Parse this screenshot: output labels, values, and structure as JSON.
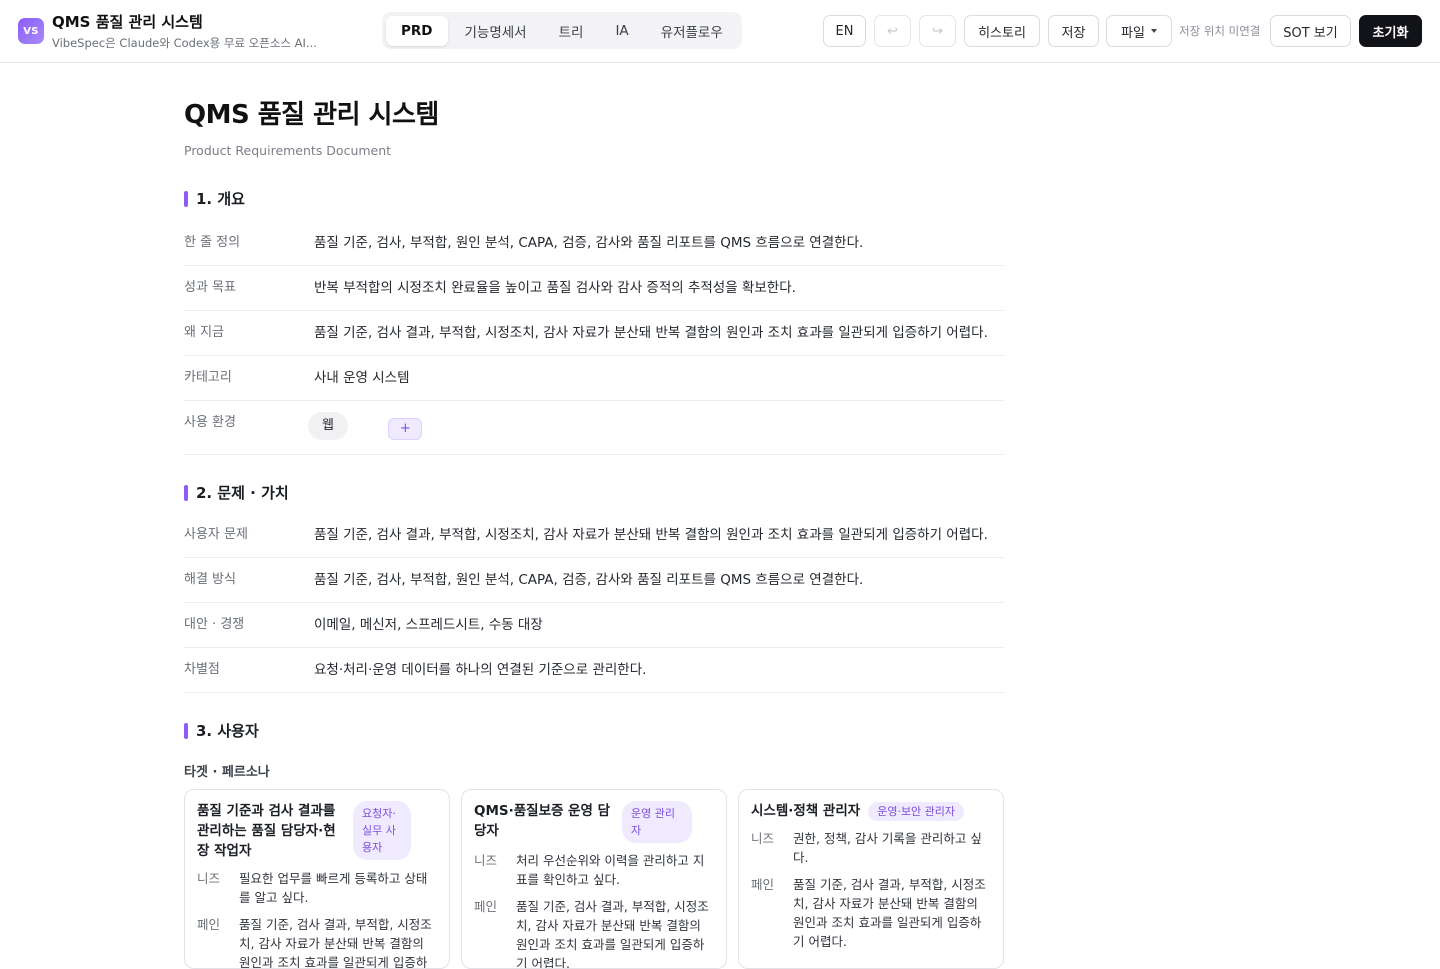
{
  "app": {
    "logo": "VS",
    "title": "QMS 품질 관리 시스템",
    "subtitle": "VibeSpec은 Claude와 Codex용 무료 오픈소스 AI..."
  },
  "tabs": [
    {
      "label": "PRD",
      "active": true
    },
    {
      "label": "기능명세서",
      "active": false
    },
    {
      "label": "트리",
      "active": false
    },
    {
      "label": "IA",
      "active": false
    },
    {
      "label": "유저플로우",
      "active": false
    }
  ],
  "toolbar": {
    "lang_label": "EN",
    "undo_icon": "↩",
    "redo_icon": "↪",
    "history_label": "히스토리",
    "save_label": "저장",
    "file_label": "파일",
    "save_status": "저장 위치 미연결",
    "sot_label": "SOT 보기",
    "reset_label": "초기화"
  },
  "doc": {
    "title": "QMS 품질 관리 시스템",
    "subtitle": "Product Requirements Document",
    "sections": {
      "overview": {
        "heading": "1. 개요",
        "rows": [
          {
            "key": "한 줄 정의",
            "value": "품질 기준, 검사, 부적합, 원인 분석, CAPA, 검증, 감사와 품질 리포트를 QMS 흐름으로 연결한다."
          },
          {
            "key": "성과 목표",
            "value": "반복 부적합의 시정조치 완료율을 높이고 품질 검사와 감사 증적의 추적성을 확보한다."
          },
          {
            "key": "왜 지금",
            "value": "품질 기준, 검사 결과, 부적합, 시정조치, 감사 자료가 분산돼 반복 결함의 원인과 조치 효과를 일관되게 입증하기 어렵다."
          },
          {
            "key": "카테고리",
            "value": "사내 운영 시스템"
          }
        ],
        "env_key": "사용 환경",
        "env_chip": "웹",
        "env_add": "+"
      },
      "problem": {
        "heading": "2. 문제 · 가치",
        "rows": [
          {
            "key": "사용자 문제",
            "value": "품질 기준, 검사 결과, 부적합, 시정조치, 감사 자료가 분산돼 반복 결함의 원인과 조치 효과를 일관되게 입증하기 어렵다."
          },
          {
            "key": "해결 방식",
            "value": "품질 기준, 검사, 부적합, 원인 분석, CAPA, 검증, 감사와 품질 리포트를 QMS 흐름으로 연결한다."
          },
          {
            "key": "대안 · 경쟁",
            "value": "이메일, 메신저, 스프레드시트, 수동 대장"
          },
          {
            "key": "차별점",
            "value": "요청·처리·운영 데이터를 하나의 연결된 기준으로 관리한다."
          }
        ]
      },
      "users": {
        "heading": "3. 사용자",
        "persona_heading": "타겟 · 페르소나",
        "personas": [
          {
            "name": "품질 기준과 검사 결과를 관리하는 품질 담당자·현장 작업자",
            "tag": "요청자·실무 사용자",
            "needs_label": "니즈",
            "needs": "필요한 업무를 빠르게 등록하고 상태를 알고 싶다.",
            "pain_label": "페인",
            "pain": "품질 기준, 검사 결과, 부적합, 시정조치, 감사 자료가 분산돼 반복 결함의 원인과 조치 효과를 일관되게 입증하기 어렵다."
          },
          {
            "name": "QMS·품질보증 운영 담당자",
            "tag": "운영 관리자",
            "needs_label": "니즈",
            "needs": "처리 우선순위와 이력을 관리하고 지표를 확인하고 싶다.",
            "pain_label": "페인",
            "pain": "품질 기준, 검사 결과, 부적합, 시정조치, 감사 자료가 분산돼 반복 결함의 원인과 조치 효과를 일관되게 입증하기 어렵다."
          },
          {
            "name": "시스템·정책 관리자",
            "tag": "운영·보안 관리자",
            "needs_label": "니즈",
            "needs": "권한, 정책, 감사 기록을 관리하고 싶다.",
            "pain_label": "페인",
            "pain": "품질 기준, 검사 결과, 부적합, 시정조치, 감사 자료가 분산돼 반복 결함의 원인과 조치 효과를 일관되게 입증하기 어렵다."
          }
        ]
      }
    }
  }
}
